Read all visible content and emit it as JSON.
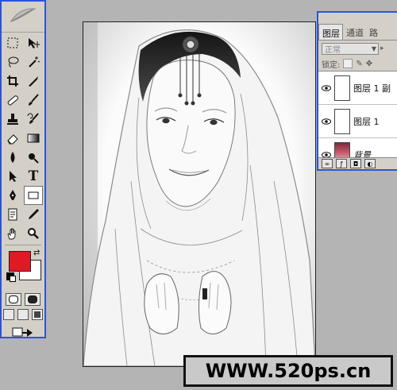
{
  "toolbox": {
    "logo_icon": "feather-icon",
    "tools": [
      {
        "name": "marquee-tool",
        "icon": "dashed-rect-icon"
      },
      {
        "name": "move-tool",
        "icon": "move-arrow-icon"
      },
      {
        "name": "lasso-tool",
        "icon": "lasso-icon"
      },
      {
        "name": "magic-wand-tool",
        "icon": "magic-wand-icon"
      },
      {
        "name": "crop-tool",
        "icon": "crop-icon"
      },
      {
        "name": "slice-tool",
        "icon": "knife-icon"
      },
      {
        "name": "healing-brush-tool",
        "icon": "bandage-icon"
      },
      {
        "name": "brush-tool",
        "icon": "brush-icon"
      },
      {
        "name": "stamp-tool",
        "icon": "stamp-icon"
      },
      {
        "name": "history-brush-tool",
        "icon": "history-brush-icon"
      },
      {
        "name": "eraser-tool",
        "icon": "eraser-icon"
      },
      {
        "name": "gradient-tool",
        "icon": "gradient-icon"
      },
      {
        "name": "blur-tool",
        "icon": "drop-icon"
      },
      {
        "name": "dodge-tool",
        "icon": "dodge-icon"
      },
      {
        "name": "path-select-tool",
        "icon": "arrow-icon"
      },
      {
        "name": "type-tool",
        "icon": "type-icon",
        "label": "T"
      },
      {
        "name": "pen-tool",
        "icon": "pen-icon"
      },
      {
        "name": "shape-tool",
        "icon": "rect-shape-icon"
      },
      {
        "name": "notes-tool",
        "icon": "notes-icon"
      },
      {
        "name": "eyedropper-tool",
        "icon": "eyedropper-icon"
      },
      {
        "name": "hand-tool",
        "icon": "hand-icon"
      },
      {
        "name": "zoom-tool",
        "icon": "magnifier-icon"
      }
    ],
    "foreground_color": "#e01a24",
    "background_color": "#ffffff"
  },
  "layers_panel": {
    "tabs": [
      "图层",
      "通道",
      "路"
    ],
    "blend_mode": "正常",
    "lock_label": "锁定:",
    "layers": [
      {
        "name": "图层 1 副",
        "visible": true,
        "thumb": "sketch"
      },
      {
        "name": "图层 1",
        "visible": true,
        "thumb": "sketch"
      },
      {
        "name": "背景",
        "visible": true,
        "thumb": "photo"
      }
    ]
  },
  "watermark": {
    "text": "WWW.520ps.cn"
  },
  "colors": {
    "accent": "#2a55d8",
    "workspace": "#b4b4b4",
    "panel": "#d4d0c8"
  }
}
